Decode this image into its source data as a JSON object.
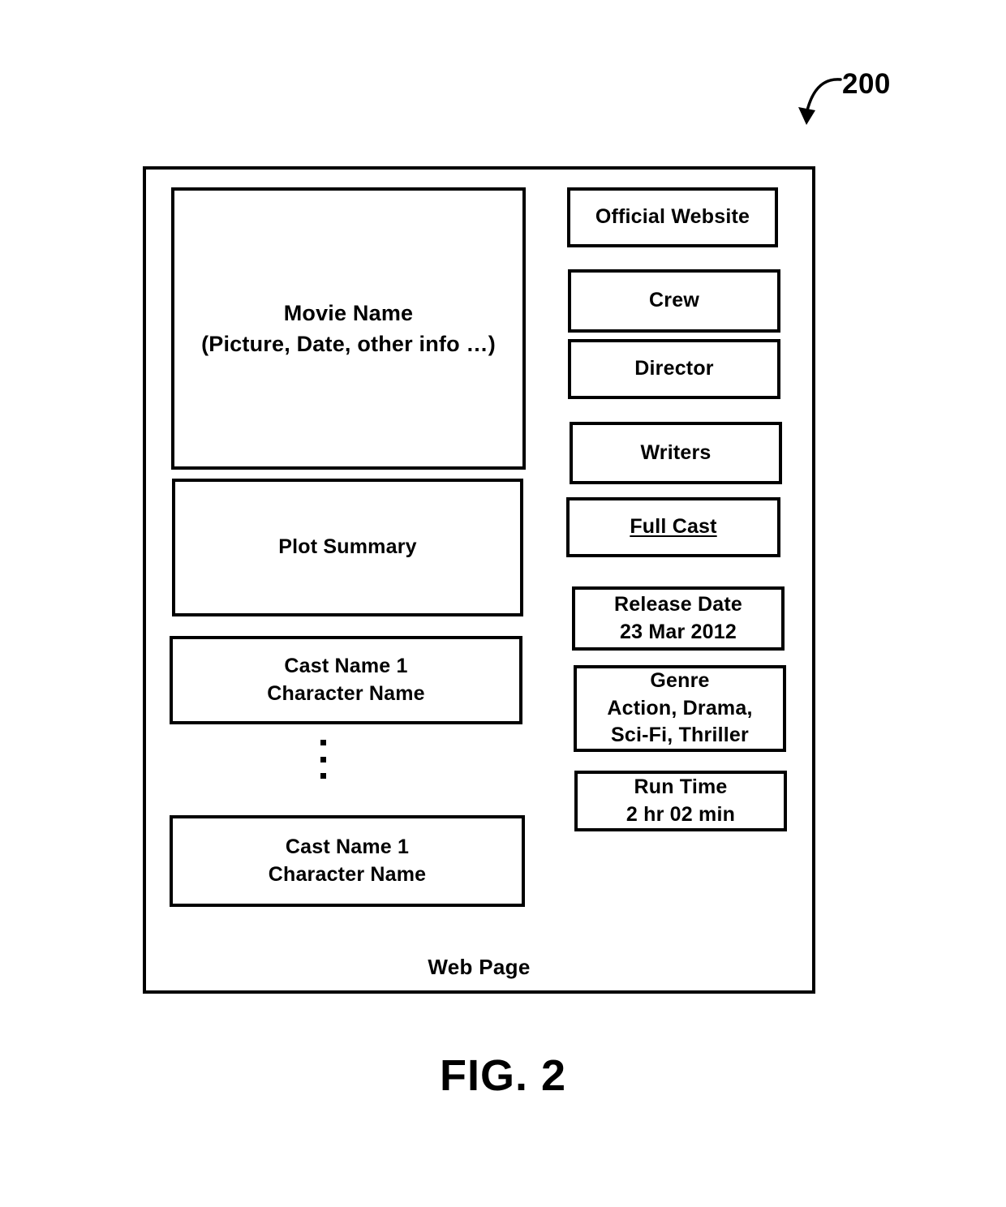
{
  "figure": {
    "reference_numeral": "200",
    "caption": "FIG. 2"
  },
  "webpage": {
    "footer_label": "Web Page",
    "left_column": {
      "movie_header": "Movie Name\n(Picture, Date, other info …)",
      "plot_summary": "Plot Summary",
      "cast_entries": [
        "Cast Name 1\nCharacter Name",
        "Cast Name 1\nCharacter Name"
      ],
      "ellipsis": "⋮"
    },
    "right_column": {
      "links": [
        {
          "label": "Official Website",
          "underlined": false
        },
        {
          "label": "Crew",
          "underlined": false
        },
        {
          "label": "Director",
          "underlined": false
        },
        {
          "label": "Writers",
          "underlined": false
        },
        {
          "label": "Full Cast",
          "underlined": true
        }
      ],
      "metadata": [
        {
          "label": "Release Date",
          "value": "23 Mar 2012",
          "text": "Release Date\n23 Mar 2012"
        },
        {
          "label": "Genre",
          "value": "Action, Drama, Sci-Fi, Thriller",
          "text": "Genre\nAction, Drama,\nSci-Fi, Thriller"
        },
        {
          "label": "Run Time",
          "value": "2 hr 02 min",
          "text": "Run Time\n2 hr 02 min"
        }
      ]
    }
  },
  "colors": {
    "ink": "#000000",
    "paper": "#ffffff"
  }
}
